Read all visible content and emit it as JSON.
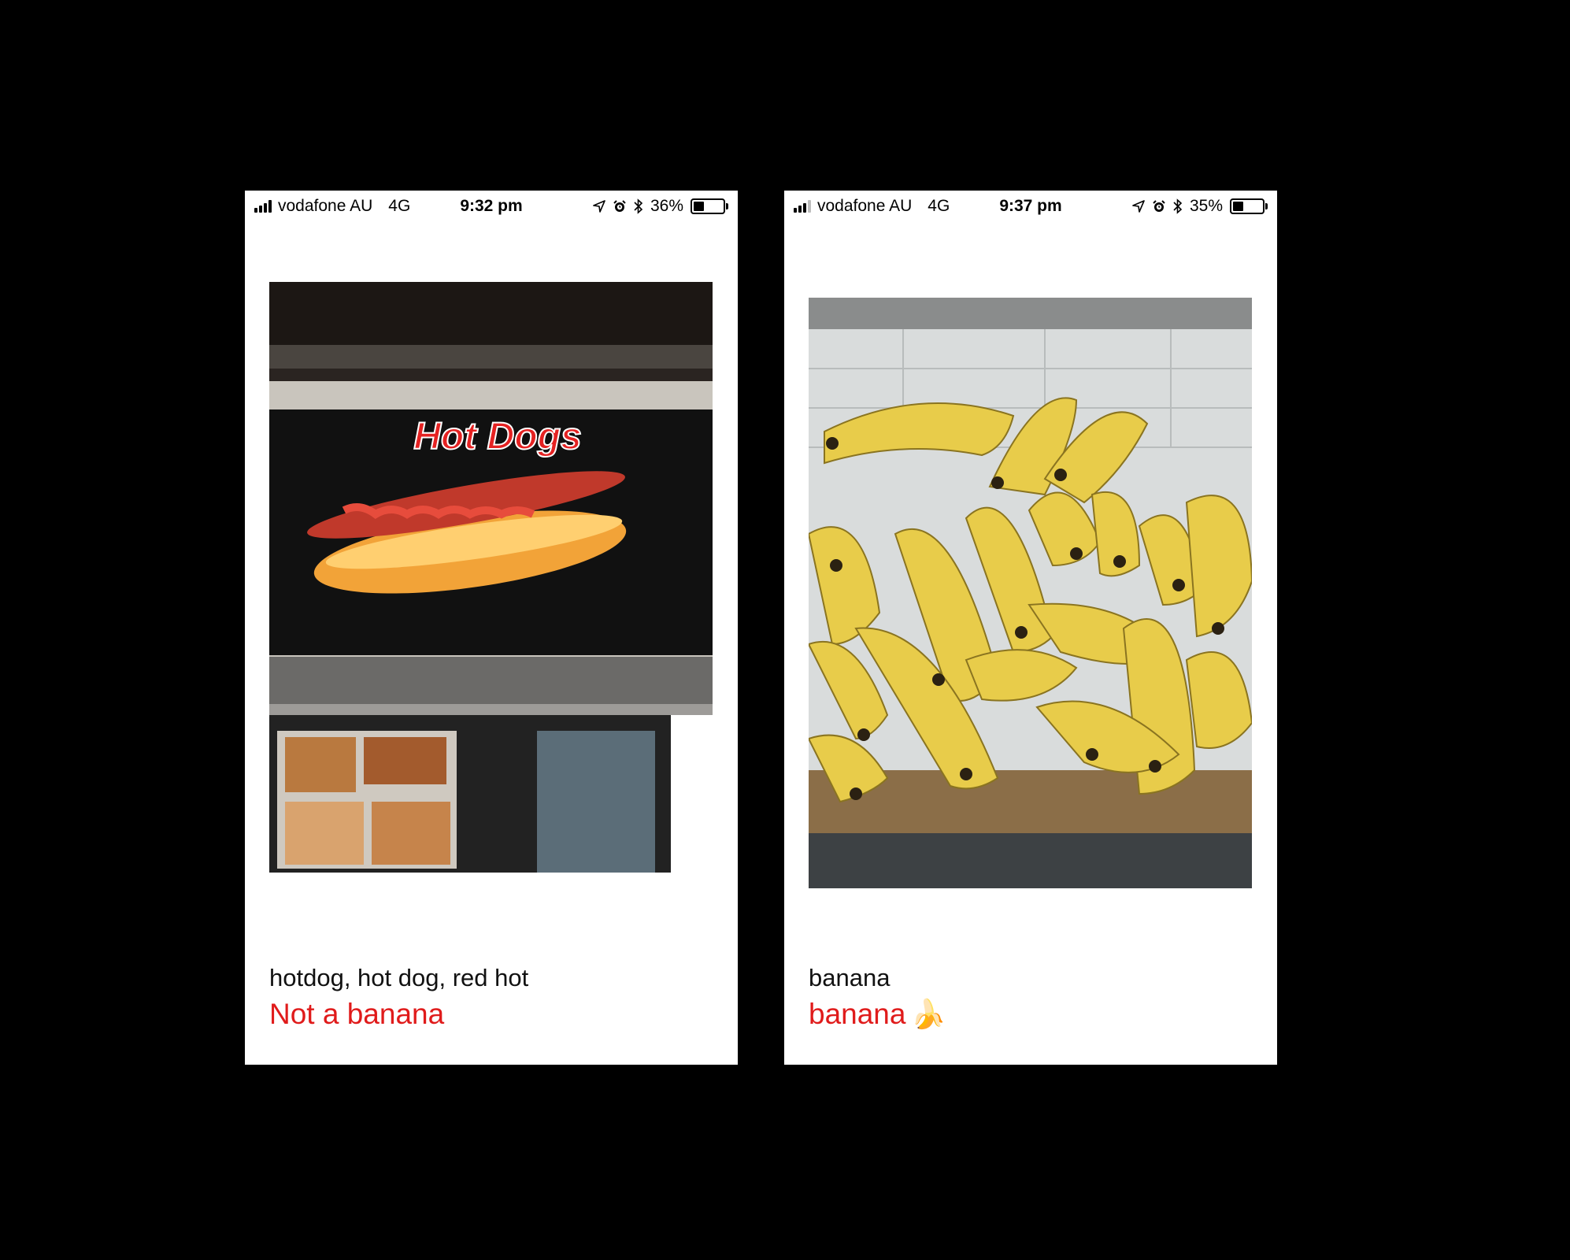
{
  "screens": [
    {
      "status": {
        "carrier": "vodafone AU",
        "network": "4G",
        "time": "9:32 pm",
        "battery": "36%",
        "battery_level": 0.36
      },
      "photo": {
        "subject": "hot dog sign",
        "sign_text": "Hot Dogs"
      },
      "prediction": "hotdog, hot dog, red hot",
      "verdict": "Not a banana",
      "verdict_emoji": ""
    },
    {
      "status": {
        "carrier": "vodafone AU",
        "network": "4G",
        "time": "9:37 pm",
        "battery": "35%",
        "battery_level": 0.35
      },
      "photo": {
        "subject": "bananas"
      },
      "prediction": "banana",
      "verdict": "banana",
      "verdict_emoji": "🍌"
    }
  ],
  "colors": {
    "verdict": "#e01b1b",
    "background": "#000000",
    "screen": "#ffffff"
  },
  "icons": [
    "signal-icon",
    "location-arrow-icon",
    "alarm-icon",
    "bluetooth-icon",
    "battery-icon"
  ]
}
